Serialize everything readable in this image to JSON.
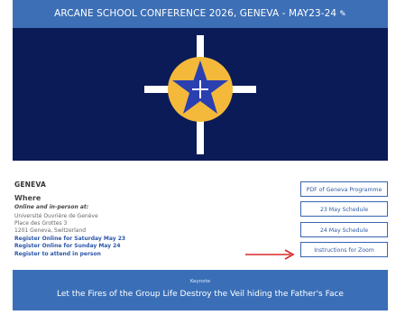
{
  "header": {
    "title": "ARCANE SCHOOL CONFERENCE 2026, GENEVA - MAY23-24",
    "edit_icon": "pencil-icon"
  },
  "hero": {
    "image_icon": "star-cross-emblem",
    "colors": {
      "background": "#0b1b58",
      "circle": "#f4b93a",
      "star": "#2a3fb0",
      "cross": "#ffffff"
    }
  },
  "event": {
    "location": "GENEVA",
    "where_heading": "Where",
    "online_label": "Online and in-person at:",
    "address": [
      "Université Ouvrière de Genève",
      "Place des Grottes 3",
      "1201 Geneva, Switzerland"
    ],
    "registration_links": [
      "Register Online for Saturday May 23",
      "Register Online for Sunday May 24",
      "Register to attend in person"
    ]
  },
  "side_buttons": [
    "PDF of Geneva Programme",
    "23 May Schedule",
    "24 May Schedule",
    "Instructions for Zoom"
  ],
  "annotation": {
    "arrow_color": "#d62828"
  },
  "keynote": {
    "label": "Keynote",
    "title": "Let the Fires of the Group Life Destroy the Veil hiding the Father's Face"
  }
}
